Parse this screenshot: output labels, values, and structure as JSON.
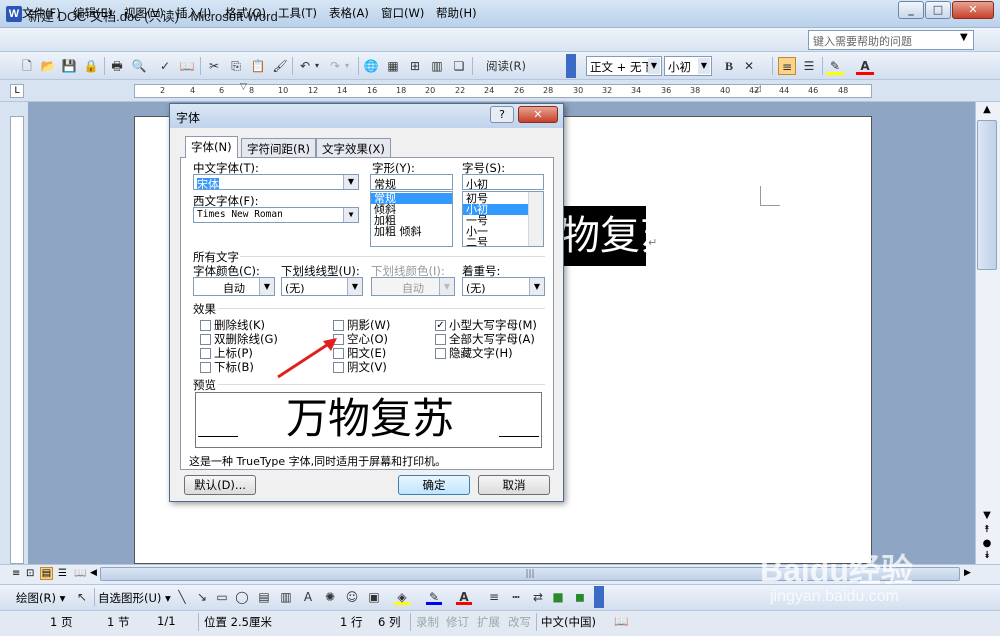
{
  "window": {
    "title": "新建 DOC 文档.doc (只读) - Microsoft Word",
    "minimize": "_",
    "maximize": "□",
    "close": "✕"
  },
  "menu": {
    "items": [
      "文件(F)",
      "编辑(E)",
      "视图(V)",
      "插入(I)",
      "格式(O)",
      "工具(T)",
      "表格(A)",
      "窗口(W)",
      "帮助(H)"
    ],
    "help_placeholder": "键入需要帮助的问题"
  },
  "toolbar": {
    "read_label": "阅读(R)",
    "style": "正文 + 无下",
    "size": "小初",
    "bold": "B"
  },
  "ruler": {
    "marks": [
      "2",
      "4",
      "6",
      "8",
      "10",
      "12",
      "14",
      "16",
      "18",
      "20",
      "22",
      "24",
      "26",
      "28",
      "30",
      "32",
      "34",
      "36",
      "38",
      "40",
      "42",
      "44",
      "46",
      "48"
    ]
  },
  "document": {
    "visible_text": "万物复苏"
  },
  "dialog": {
    "title": "字体",
    "help": "?",
    "close": "✕",
    "tabs": [
      "字体(N)",
      "字符间距(R)",
      "文字效果(X)"
    ],
    "cn_font_label": "中文字体(T):",
    "cn_font_value": "宋体",
    "west_font_label": "西文字体(F):",
    "west_font_value": "Times New Roman",
    "style_label": "字形(Y):",
    "style_value": "常规",
    "style_options": [
      "常规",
      "倾斜",
      "加粗",
      "加粗 倾斜"
    ],
    "size_label": "字号(S):",
    "size_value": "小初",
    "size_options": [
      "初号",
      "小初",
      "一号",
      "小一",
      "二号"
    ],
    "all_text_label": "所有文字",
    "font_color_label": "字体颜色(C):",
    "font_color_value": "自动",
    "underline_label": "下划线线型(U):",
    "underline_value": "(无)",
    "underline_color_label": "下划线颜色(I):",
    "underline_color_value": "自动",
    "emphasis_label": "着重号:",
    "emphasis_value": "(无)",
    "effects_label": "效果",
    "effects": [
      {
        "label": "删除线(K)",
        "checked": false
      },
      {
        "label": "双删除线(G)",
        "checked": false
      },
      {
        "label": "上标(P)",
        "checked": false
      },
      {
        "label": "下标(B)",
        "checked": false
      },
      {
        "label": "阴影(W)",
        "checked": false
      },
      {
        "label": "空心(O)",
        "checked": false
      },
      {
        "label": "阳文(E)",
        "checked": false
      },
      {
        "label": "阴文(V)",
        "checked": false
      },
      {
        "label": "小型大写字母(M)",
        "checked": true
      },
      {
        "label": "全部大写字母(A)",
        "checked": false
      },
      {
        "label": "隐藏文字(H)",
        "checked": false
      }
    ],
    "preview_label": "预览",
    "preview_text": "万物复苏",
    "note": "这是一种 TrueType 字体,同时适用于屏幕和打印机。",
    "default_btn": "默认(D)...",
    "ok_btn": "确定",
    "cancel_btn": "取消"
  },
  "drawbar": {
    "draw": "绘图(R)",
    "autoshape": "自选图形(U)"
  },
  "status": {
    "page": "1 页",
    "section": "1 节",
    "pages": "1/1",
    "position": "位置 2.5厘米",
    "line": "1 行",
    "col": "6 列",
    "rec": "录制",
    "rev": "修订",
    "ext": "扩展",
    "ovr": "改写",
    "lang": "中文(中国)"
  },
  "watermark": {
    "brand": "Baidu经验",
    "url": "jingyan.baidu.com"
  }
}
